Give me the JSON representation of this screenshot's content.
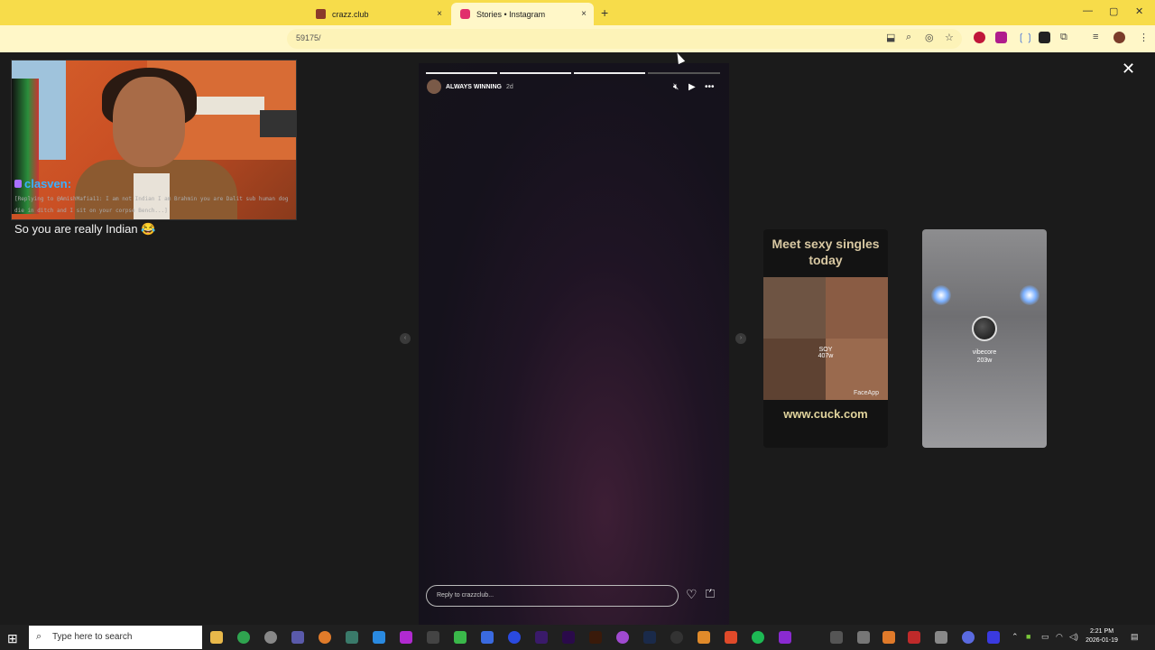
{
  "browser": {
    "tabs": [
      {
        "label": "crazz.club",
        "favicon_color": "#8a3a2a"
      },
      {
        "label": "Stories • Instagram",
        "favicon_color": "#e1306c"
      }
    ],
    "url_fragment": "59175/",
    "new_tab_symbol": "+",
    "close_symbol": "×",
    "accent_color": "#f9e05a"
  },
  "overlay": {
    "chat": {
      "username": "clasven:",
      "reply_context": "[Replying to @AmishMafia11: I am not Indian I am Brahmin you are Dalit sub human dog die in ditch and I sit on your corpse Bench...]",
      "message": "So you are really Indian 😂"
    }
  },
  "story": {
    "username": "ALWAYS WINNING",
    "time_ago": "2d",
    "progress_segments": [
      1,
      1,
      1,
      0
    ],
    "reply_placeholder": "Reply to crazzclub...",
    "icons": {
      "mute": "mute-icon",
      "play": "play-icon",
      "more": "more-icon",
      "heart": "heart-icon",
      "send": "send-icon",
      "close": "close-icon"
    }
  },
  "next_stories": [
    {
      "ad_title": "Meet sexy singles today",
      "username": "SOY",
      "time_ago": "407w",
      "watermark": "FaceApp",
      "ad_url": "www.cuck.com"
    },
    {
      "username": "vibecore",
      "time_ago": "203w"
    }
  ],
  "taskbar": {
    "search_placeholder": "Type here to search",
    "time": "2:21 PM",
    "date": "2026-01-19"
  }
}
